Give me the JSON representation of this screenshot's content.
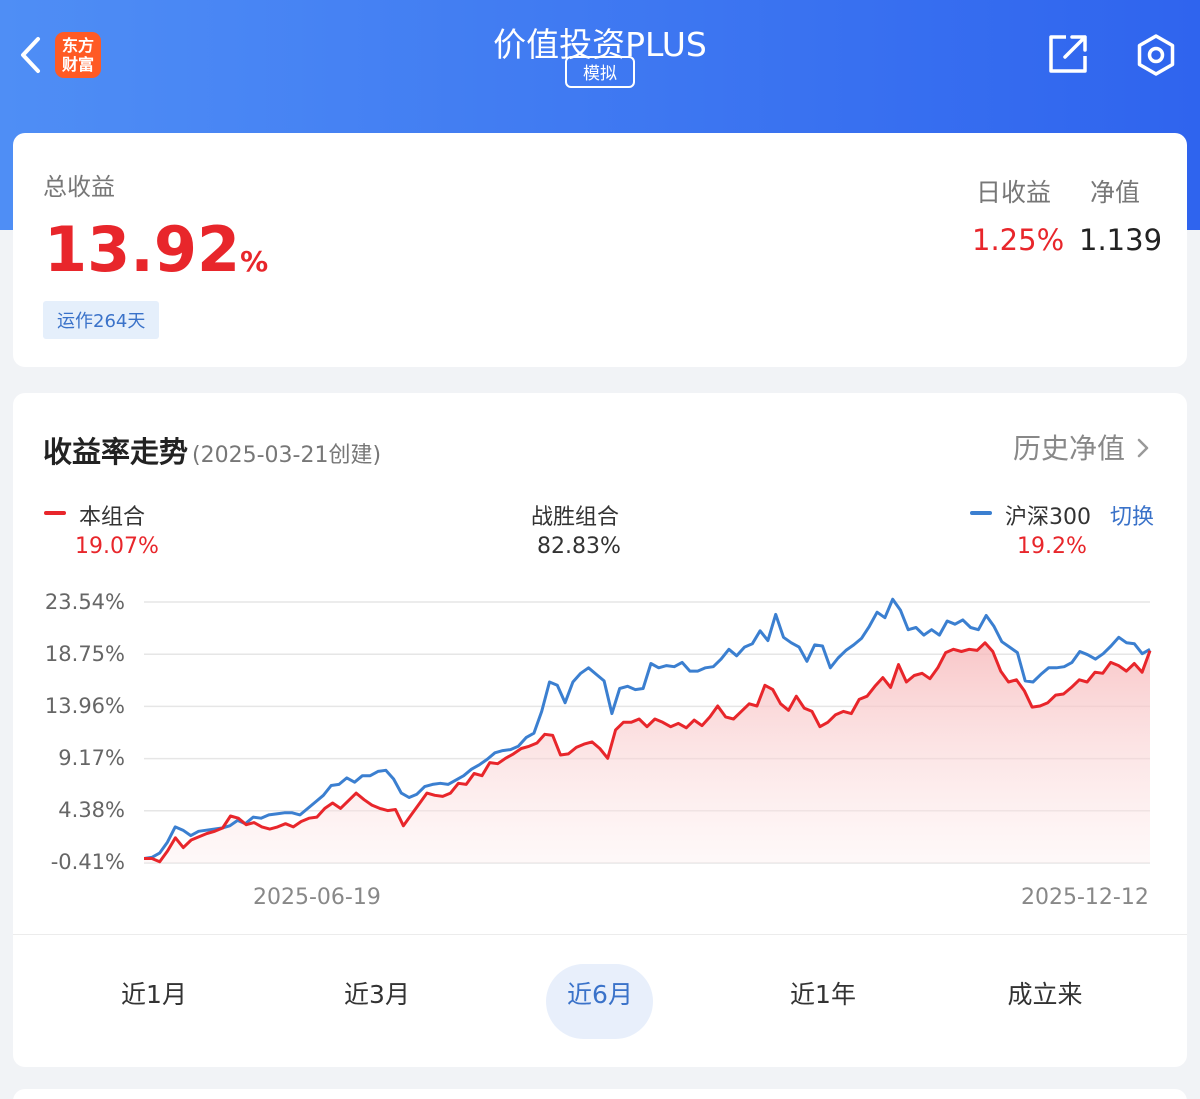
{
  "header": {
    "title": "价值投资PLUS",
    "badge": "模拟",
    "logo_line1": "东方",
    "logo_line2": "财富",
    "colors": {
      "gradient_start": "#4f8ef5",
      "gradient_end": "#2f64ee"
    },
    "icons": [
      "back-icon",
      "share-icon",
      "settings-icon"
    ]
  },
  "summary": {
    "total_label": "总收益",
    "total_value": "13.92",
    "total_unit": "%",
    "days_label": "运作264天",
    "daily_label": "日收益",
    "daily_value": "1.25%",
    "nav_label": "净值",
    "nav_value": "1.139"
  },
  "trend": {
    "title": "收益率走势",
    "created": "(2025-03-21创建)",
    "history_link": "历史净值",
    "legend": {
      "portfolio_label": "本组合",
      "portfolio_value": "19.07%",
      "beat_label": "战胜组合",
      "beat_value": "82.83%",
      "benchmark_label": "沪深300",
      "benchmark_value": "19.2%",
      "switch_label": "切换"
    }
  },
  "periods": {
    "items": [
      "近1月",
      "近3月",
      "近6月",
      "近1年",
      "成立来"
    ],
    "active_index": 2
  },
  "chart_data": {
    "type": "line",
    "x_start": "2025-06-19",
    "x_end": "2025-12-12",
    "x_tick_labels": [
      "2025-06-19",
      "2025-12-12"
    ],
    "y_tick_labels": [
      "23.54%",
      "18.75%",
      "13.96%",
      "9.17%",
      "4.38%",
      "-0.41%"
    ],
    "y_ticks": [
      23.54,
      18.75,
      13.96,
      9.17,
      4.38,
      -0.41
    ],
    "ylim": [
      -0.41,
      23.54
    ],
    "grid": true,
    "series": [
      {
        "name": "本组合",
        "color": "#e8262b",
        "area": true,
        "values": [
          0.0,
          0.0,
          -0.3,
          0.7,
          1.9,
          1.0,
          1.7,
          2.0,
          2.3,
          2.5,
          2.8,
          3.9,
          3.7,
          3.1,
          3.3,
          2.9,
          2.7,
          2.9,
          3.2,
          2.9,
          3.4,
          3.7,
          3.8,
          4.6,
          5.1,
          4.6,
          5.3,
          6.0,
          5.4,
          4.9,
          4.6,
          4.4,
          4.5,
          3.0,
          4.0,
          5.0,
          6.0,
          5.8,
          5.7,
          6.0,
          6.9,
          6.8,
          7.8,
          7.6,
          8.8,
          8.7,
          9.2,
          9.6,
          10.1,
          10.3,
          10.6,
          11.4,
          11.3,
          9.5,
          9.6,
          10.2,
          10.5,
          10.7,
          10.1,
          9.2,
          11.8,
          12.5,
          12.5,
          12.8,
          12.1,
          12.8,
          12.5,
          12.1,
          12.4,
          12.0,
          12.7,
          12.2,
          13.0,
          14.0,
          13.0,
          12.8,
          13.5,
          14.2,
          14.0,
          15.9,
          15.5,
          14.2,
          13.6,
          14.9,
          13.8,
          13.5,
          12.1,
          12.5,
          13.2,
          13.5,
          13.3,
          14.6,
          14.9,
          15.8,
          16.6,
          15.7,
          17.8,
          16.2,
          16.8,
          17.0,
          16.5,
          17.5,
          18.9,
          19.2,
          19.0,
          19.2,
          19.1,
          19.8,
          19.0,
          17.2,
          16.2,
          16.4,
          15.4,
          13.9,
          14.0,
          14.3,
          15.0,
          15.1,
          15.7,
          16.4,
          16.2,
          17.1,
          17.0,
          18.0,
          17.7,
          17.2,
          17.9,
          17.1,
          19.07
        ]
      },
      {
        "name": "沪深300",
        "color": "#3b7fd0",
        "area": false,
        "values": [
          0.0,
          0.1,
          0.5,
          1.5,
          2.9,
          2.6,
          2.1,
          2.5,
          2.6,
          2.7,
          2.8,
          3.0,
          3.5,
          3.2,
          3.8,
          3.7,
          4.0,
          4.1,
          4.2,
          4.2,
          4.0,
          4.6,
          5.2,
          5.8,
          6.7,
          6.8,
          7.4,
          7.0,
          7.6,
          7.6,
          8.0,
          8.1,
          7.3,
          6.0,
          5.6,
          5.9,
          6.6,
          6.8,
          6.9,
          6.8,
          7.2,
          7.6,
          8.2,
          8.6,
          9.1,
          9.7,
          9.9,
          10.0,
          10.3,
          11.1,
          11.5,
          13.5,
          16.2,
          15.9,
          14.3,
          16.2,
          17.0,
          17.5,
          16.9,
          16.3,
          13.3,
          15.6,
          15.8,
          15.5,
          15.6,
          17.9,
          17.5,
          17.7,
          17.6,
          18.0,
          17.2,
          17.2,
          17.5,
          17.6,
          18.3,
          19.2,
          18.6,
          19.4,
          19.7,
          20.9,
          20.0,
          22.4,
          20.3,
          19.8,
          19.4,
          18.1,
          19.6,
          19.5,
          17.5,
          18.4,
          19.1,
          19.6,
          20.2,
          21.3,
          22.6,
          22.1,
          23.8,
          22.8,
          21.0,
          21.2,
          20.5,
          21.0,
          20.5,
          21.8,
          21.5,
          21.9,
          21.2,
          21.0,
          22.3,
          21.3,
          19.9,
          19.4,
          18.9,
          16.3,
          16.2,
          16.9,
          17.5,
          17.5,
          17.6,
          18.0,
          19.0,
          18.7,
          18.3,
          18.8,
          19.5,
          20.3,
          19.8,
          19.7,
          18.8,
          19.2
        ]
      }
    ]
  }
}
